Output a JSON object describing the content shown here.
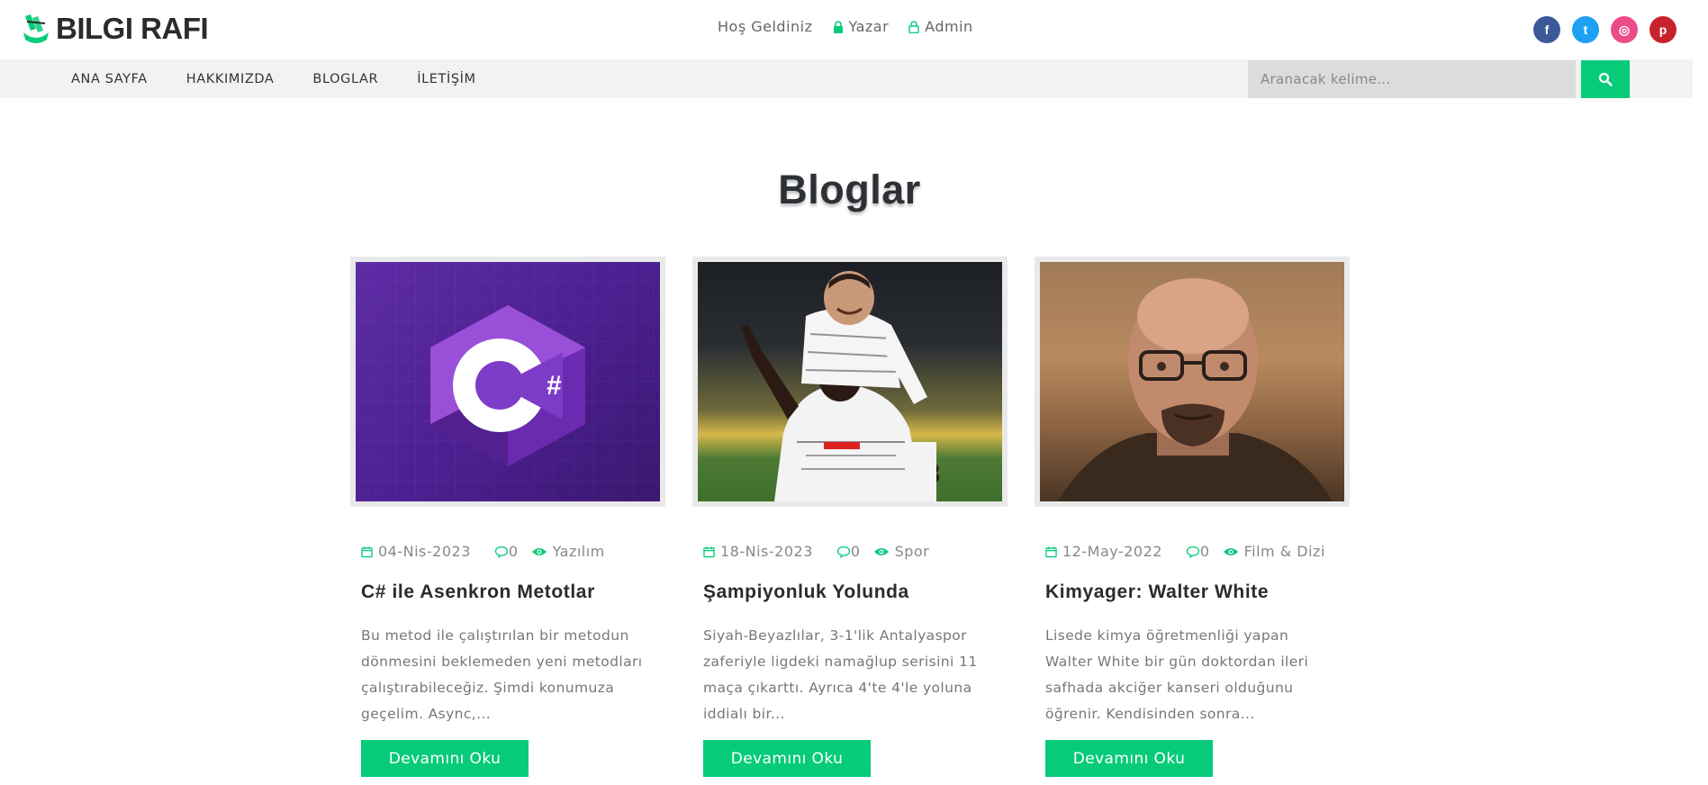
{
  "brand": {
    "name": "BILGI RAFI"
  },
  "top_links": {
    "welcome": "Hoş Geldiniz",
    "author": "Yazar",
    "admin": "Admin"
  },
  "social": [
    {
      "icon": "facebook-icon",
      "glyph": "f",
      "color": "#3b5998"
    },
    {
      "icon": "twitter-icon",
      "glyph": "t",
      "color": "#1da1f2"
    },
    {
      "icon": "dribbble-icon",
      "glyph": "◎",
      "color": "#ea4c89"
    },
    {
      "icon": "pinterest-icon",
      "glyph": "p",
      "color": "#c8232c"
    }
  ],
  "nav": {
    "items": [
      "ANA SAYFA",
      "HAKKIMIZDA",
      "BLOGLAR",
      "İLETİŞİM"
    ]
  },
  "search": {
    "placeholder": "Aranacak kelime..."
  },
  "colors": {
    "accent": "#07cb79",
    "heading": "#2d3136"
  },
  "section": {
    "title": "Bloglar"
  },
  "posts": [
    {
      "date": "04-Nis-2023",
      "comments": "0",
      "category": "Yazılım",
      "title": "C# ile Asenkron Metotlar",
      "excerpt": "Bu metod ile çalıştırılan bir metodun dönmesini beklemeden yeni metodları çalıştırabileceğiz. Şimdi konumuza geçelim. Async,...",
      "button": "Devamını Oku",
      "image": "csharp-logo"
    },
    {
      "date": "18-Nis-2023",
      "comments": "0",
      "category": "Spor",
      "title": "Şampiyonluk Yolunda",
      "excerpt": "Siyah-Beyazlılar, 3-1'lik Antalyaspor zaferiyle ligdeki namağlup serisini 11 maça çıkarttı. Ayrıca 4'te 4'le yoluna iddialı bir...",
      "button": "Devamını Oku",
      "image": "football-players-photo"
    },
    {
      "date": "12-May-2022",
      "comments": "0",
      "category": "Film & Dizi",
      "title": "Kimyager: Walter White",
      "excerpt": "Lisede kimya öğretmenliği yapan Walter White bir gün doktordan ileri safhada akciğer kanseri olduğunu öğrenir. Kendisinden sonra...",
      "button": "Devamını Oku",
      "image": "portrait-photo"
    }
  ]
}
